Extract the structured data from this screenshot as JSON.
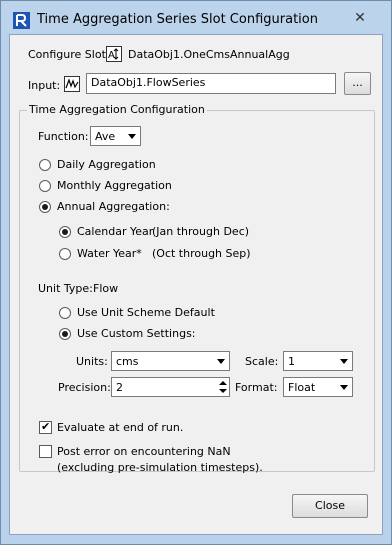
{
  "window": {
    "title": "Time Aggregation Series Slot Configuration",
    "close_glyph": "✕"
  },
  "configure_slot": {
    "label": "Configure Slot:",
    "value": "DataObj1.OneCmsAnnualAgg"
  },
  "input": {
    "label": "Input:",
    "value": "DataObj1.FlowSeries",
    "browse_label": "..."
  },
  "group": {
    "title": "Time Aggregation Configuration",
    "function_label": "Function:",
    "function_value": "Ave",
    "aggregation_options": [
      {
        "label": "Daily Aggregation",
        "selected": false
      },
      {
        "label": "Monthly Aggregation",
        "selected": false
      },
      {
        "label": "Annual Aggregation:",
        "selected": true
      }
    ],
    "year_options": [
      {
        "label": "Calendar Year",
        "note": "(Jan through Dec)",
        "selected": true
      },
      {
        "label": "Water Year*",
        "note": "(Oct through Sep)",
        "selected": false
      }
    ],
    "unit_type_label": "Unit Type:",
    "unit_type_value": "Flow",
    "unit_options": [
      {
        "label": "Use Unit Scheme Default",
        "selected": false
      },
      {
        "label": "Use Custom Settings:",
        "selected": true
      }
    ],
    "units_label": "Units:",
    "units_value": "cms",
    "scale_label": "Scale:",
    "scale_value": "1",
    "precision_label": "Precision:",
    "precision_value": "2",
    "format_label": "Format:",
    "format_value": "Float",
    "evaluate_label": "Evaluate at end of run.",
    "evaluate_checked": true,
    "post_error_label": "Post error on encountering NaN",
    "post_error_sub": "(excluding pre-simulation timesteps).",
    "post_error_checked": false
  },
  "footer": {
    "close_label": "Close"
  }
}
